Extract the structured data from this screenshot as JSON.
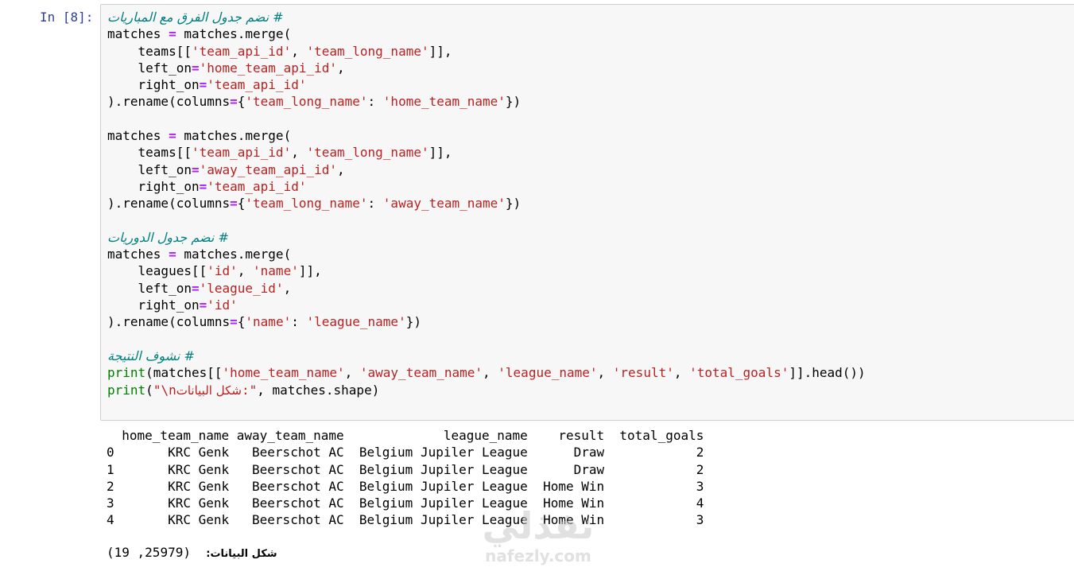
{
  "cell": {
    "prompt": "In [8]:",
    "lines": [
      [
        {
          "t": "cm",
          "v": "# نضم جدول الفرق مع المباريات"
        }
      ],
      [
        {
          "t": "n",
          "v": "matches "
        },
        {
          "t": "op",
          "v": "="
        },
        {
          "t": "n",
          "v": " matches.merge("
        }
      ],
      [
        {
          "t": "n",
          "v": "    teams[["
        },
        {
          "t": "str",
          "v": "'team_api_id'"
        },
        {
          "t": "n",
          "v": ", "
        },
        {
          "t": "str",
          "v": "'team_long_name'"
        },
        {
          "t": "n",
          "v": "]],"
        }
      ],
      [
        {
          "t": "n",
          "v": "    left_on"
        },
        {
          "t": "op",
          "v": "="
        },
        {
          "t": "str",
          "v": "'home_team_api_id'"
        },
        {
          "t": "n",
          "v": ","
        }
      ],
      [
        {
          "t": "n",
          "v": "    right_on"
        },
        {
          "t": "op",
          "v": "="
        },
        {
          "t": "str",
          "v": "'team_api_id'"
        }
      ],
      [
        {
          "t": "n",
          "v": ").rename(columns"
        },
        {
          "t": "op",
          "v": "="
        },
        {
          "t": "n",
          "v": "{"
        },
        {
          "t": "str",
          "v": "'team_long_name'"
        },
        {
          "t": "n",
          "v": ": "
        },
        {
          "t": "str",
          "v": "'home_team_name'"
        },
        {
          "t": "n",
          "v": "})"
        }
      ],
      [],
      [
        {
          "t": "n",
          "v": "matches "
        },
        {
          "t": "op",
          "v": "="
        },
        {
          "t": "n",
          "v": " matches.merge("
        }
      ],
      [
        {
          "t": "n",
          "v": "    teams[["
        },
        {
          "t": "str",
          "v": "'team_api_id'"
        },
        {
          "t": "n",
          "v": ", "
        },
        {
          "t": "str",
          "v": "'team_long_name'"
        },
        {
          "t": "n",
          "v": "]],"
        }
      ],
      [
        {
          "t": "n",
          "v": "    left_on"
        },
        {
          "t": "op",
          "v": "="
        },
        {
          "t": "str",
          "v": "'away_team_api_id'"
        },
        {
          "t": "n",
          "v": ","
        }
      ],
      [
        {
          "t": "n",
          "v": "    right_on"
        },
        {
          "t": "op",
          "v": "="
        },
        {
          "t": "str",
          "v": "'team_api_id'"
        }
      ],
      [
        {
          "t": "n",
          "v": ").rename(columns"
        },
        {
          "t": "op",
          "v": "="
        },
        {
          "t": "n",
          "v": "{"
        },
        {
          "t": "str",
          "v": "'team_long_name'"
        },
        {
          "t": "n",
          "v": ": "
        },
        {
          "t": "str",
          "v": "'away_team_name'"
        },
        {
          "t": "n",
          "v": "})"
        }
      ],
      [],
      [
        {
          "t": "cm",
          "v": "# نضم جدول الدوريات"
        }
      ],
      [
        {
          "t": "n",
          "v": "matches "
        },
        {
          "t": "op",
          "v": "="
        },
        {
          "t": "n",
          "v": " matches.merge("
        }
      ],
      [
        {
          "t": "n",
          "v": "    leagues[["
        },
        {
          "t": "str",
          "v": "'id'"
        },
        {
          "t": "n",
          "v": ", "
        },
        {
          "t": "str",
          "v": "'name'"
        },
        {
          "t": "n",
          "v": "]],"
        }
      ],
      [
        {
          "t": "n",
          "v": "    left_on"
        },
        {
          "t": "op",
          "v": "="
        },
        {
          "t": "str",
          "v": "'league_id'"
        },
        {
          "t": "n",
          "v": ","
        }
      ],
      [
        {
          "t": "n",
          "v": "    right_on"
        },
        {
          "t": "op",
          "v": "="
        },
        {
          "t": "str",
          "v": "'id'"
        }
      ],
      [
        {
          "t": "n",
          "v": ").rename(columns"
        },
        {
          "t": "op",
          "v": "="
        },
        {
          "t": "n",
          "v": "{"
        },
        {
          "t": "str",
          "v": "'name'"
        },
        {
          "t": "n",
          "v": ": "
        },
        {
          "t": "str",
          "v": "'league_name'"
        },
        {
          "t": "n",
          "v": "})"
        }
      ],
      [],
      [
        {
          "t": "cm",
          "v": "# نشوف النتيجة"
        }
      ],
      [
        {
          "t": "kw",
          "v": "print"
        },
        {
          "t": "n",
          "v": "(matches[["
        },
        {
          "t": "str",
          "v": "'home_team_name'"
        },
        {
          "t": "n",
          "v": ", "
        },
        {
          "t": "str",
          "v": "'away_team_name'"
        },
        {
          "t": "n",
          "v": ", "
        },
        {
          "t": "str",
          "v": "'league_name'"
        },
        {
          "t": "n",
          "v": ", "
        },
        {
          "t": "str",
          "v": "'result'"
        },
        {
          "t": "n",
          "v": ", "
        },
        {
          "t": "str",
          "v": "'total_goals'"
        },
        {
          "t": "n",
          "v": "]].head())"
        }
      ],
      [
        {
          "t": "kw",
          "v": "print"
        },
        {
          "t": "n",
          "v": "("
        },
        {
          "t": "str",
          "v": "\"\\n"
        },
        {
          "t": "str_ar",
          "v": "شكل البيانات"
        },
        {
          "t": "str",
          "v": ":\""
        },
        {
          "t": "n",
          "v": ", matches.shape)"
        }
      ]
    ]
  },
  "output": {
    "table_header": "  home_team_name away_team_name             league_name    result  total_goals",
    "table_rows": [
      "0       KRC Genk   Beerschot AC  Belgium Jupiler League      Draw            2",
      "1       KRC Genk   Beerschot AC  Belgium Jupiler League      Draw            2",
      "2       KRC Genk   Beerschot AC  Belgium Jupiler League  Home Win            3",
      "3       KRC Genk   Beerschot AC  Belgium Jupiler League  Home Win            4",
      "4       KRC Genk   Beerschot AC  Belgium Jupiler League  Home Win            3"
    ],
    "shape_label": "شكل البيانات:",
    "shape_value": "(25979, 19)"
  },
  "watermark": {
    "logo_text": "نفذلي",
    "url": "nafezly.com"
  },
  "colors": {
    "prompt": "#303f9f",
    "cell_bg": "#f7f7f7",
    "cell_border": "#cfcfcf",
    "string": "#ba2121",
    "comment": "#008080",
    "keyword": "#008000",
    "operator": "#aa22ff"
  }
}
